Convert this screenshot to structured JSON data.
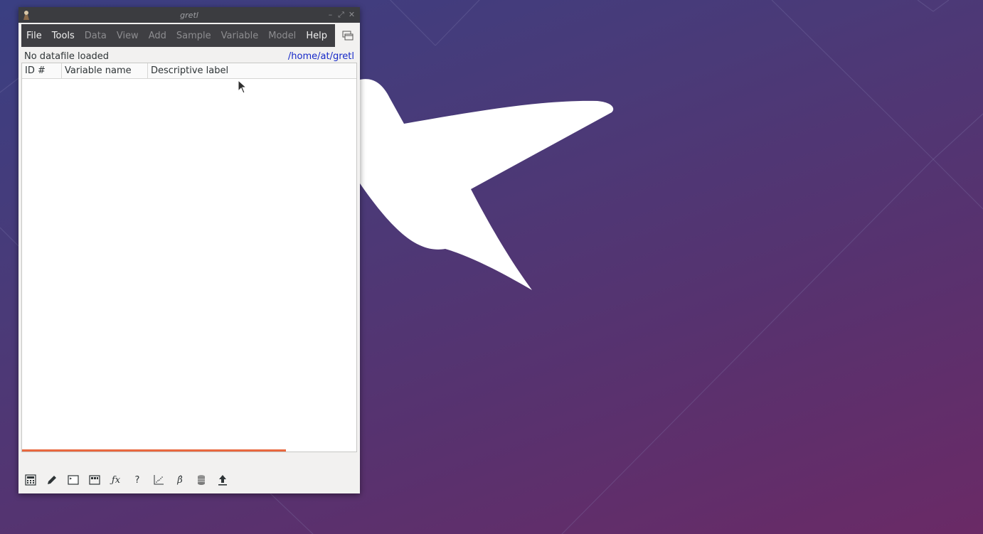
{
  "window": {
    "title": "gretl",
    "controls": [
      "–",
      "⤢",
      "✕"
    ]
  },
  "menubar": {
    "items": [
      {
        "label": "File",
        "enabled": true
      },
      {
        "label": "Tools",
        "enabled": true
      },
      {
        "label": "Data",
        "enabled": false
      },
      {
        "label": "View",
        "enabled": false
      },
      {
        "label": "Add",
        "enabled": false
      },
      {
        "label": "Sample",
        "enabled": false
      },
      {
        "label": "Variable",
        "enabled": false
      },
      {
        "label": "Model",
        "enabled": false
      },
      {
        "label": "Help",
        "enabled": true
      }
    ]
  },
  "status": {
    "datafile": "No datafile loaded",
    "workdir": "/home/at/gretl"
  },
  "table": {
    "columns": [
      "ID #",
      "Variable name",
      "Descriptive label"
    ],
    "rows": []
  },
  "progress": {
    "fraction": 0.79,
    "color": "#e9683f"
  },
  "toolbar": {
    "icons": [
      "calculator-icon",
      "edit-icon",
      "console-icon",
      "session-icon",
      "function-icon",
      "help-icon",
      "plot-icon",
      "beta-icon",
      "database-icon",
      "upload-icon"
    ],
    "fx_label": "ƒx",
    "help_label": "?",
    "beta_label": "β̂"
  },
  "colors": {
    "accent": "#e9683f",
    "link": "#1528c8",
    "menubar": "#3f3f43"
  }
}
